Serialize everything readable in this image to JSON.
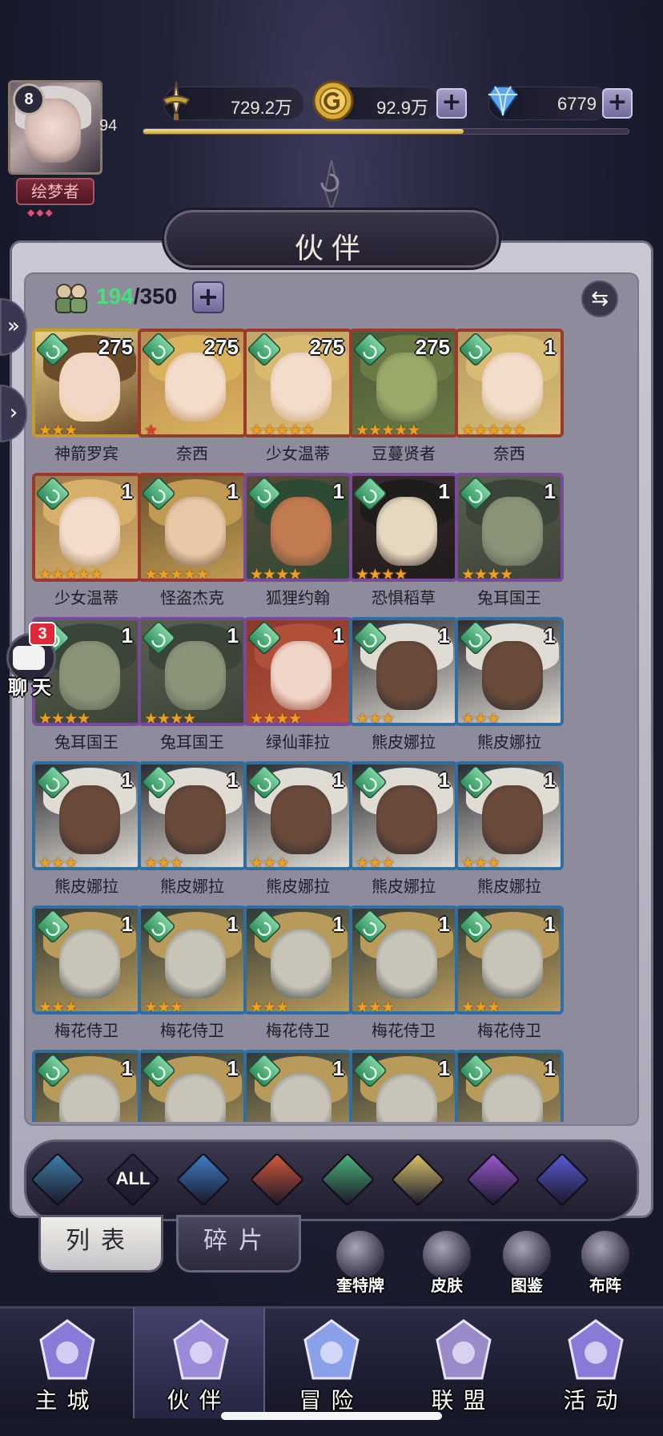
{
  "player": {
    "level": "8",
    "exp_value": "94",
    "exp_fraction": 0.66,
    "title_badge": "绘梦者"
  },
  "resources": {
    "power": "729.2万",
    "gold": "92.9万",
    "gems": "6779",
    "plus": "+"
  },
  "page_title": "伙伴",
  "roster": {
    "current": "194",
    "max": "/350"
  },
  "companions": [
    {
      "name": "神箭罗宾",
      "level": "275",
      "stars": 3,
      "frame": "gold",
      "palette": [
        "#e9d08a",
        "#6b4a2a",
        "#f2d6c8"
      ]
    },
    {
      "name": "奈西",
      "level": "275",
      "stars": 1,
      "frame": "red",
      "palette": [
        "#b98a52",
        "#d9b25e",
        "#f4dccb"
      ]
    },
    {
      "name": "少女温蒂",
      "level": "275",
      "stars": 5,
      "frame": "red",
      "palette": [
        "#c2a36a",
        "#d9b870",
        "#f3dccc"
      ]
    },
    {
      "name": "豆蔓贤者",
      "level": "275",
      "stars": 5,
      "frame": "red",
      "palette": [
        "#4a5a38",
        "#6a7a44",
        "#9aa86a"
      ]
    },
    {
      "name": "奈西",
      "level": "1",
      "stars": 5,
      "frame": "red",
      "palette": [
        "#b99a62",
        "#d9bc74",
        "#f3dccc"
      ]
    },
    {
      "name": "少女温蒂",
      "level": "1",
      "stars": 5,
      "frame": "red",
      "palette": [
        "#9a7a4a",
        "#d6b06a",
        "#f3dccc"
      ]
    },
    {
      "name": "怪盗杰克",
      "level": "1",
      "stars": 5,
      "frame": "red",
      "palette": [
        "#6a5230",
        "#c09a52",
        "#e9c8a8"
      ]
    },
    {
      "name": "狐狸约翰",
      "level": "1",
      "stars": 4,
      "frame": "purple",
      "palette": [
        "#5a4a3a",
        "#2f4a34",
        "#c27a50"
      ]
    },
    {
      "name": "恐惧稻草",
      "level": "1",
      "stars": 4,
      "frame": "purple",
      "palette": [
        "#3a2a2a",
        "#1f1c1c",
        "#e6d8c0"
      ]
    },
    {
      "name": "兔耳国王",
      "level": "1",
      "stars": 4,
      "frame": "purple",
      "palette": [
        "#5a6050",
        "#3b4438",
        "#8a9478"
      ]
    },
    {
      "name": "兔耳国王",
      "level": "1",
      "stars": 4,
      "frame": "purple",
      "palette": [
        "#5a6050",
        "#3b4438",
        "#8a9478"
      ]
    },
    {
      "name": "兔耳国王",
      "level": "1",
      "stars": 4,
      "frame": "purple",
      "palette": [
        "#5a6050",
        "#3b4438",
        "#8a9478"
      ]
    },
    {
      "name": "绿仙菲拉",
      "level": "1",
      "stars": 4,
      "frame": "purple",
      "palette": [
        "#8a3a2a",
        "#b0503a",
        "#f0d6c8"
      ]
    },
    {
      "name": "熊皮娜拉",
      "level": "1",
      "stars": 3,
      "frame": "blue",
      "palette": [
        "#2a2a30",
        "#e0dcd4",
        "#6a4a3a"
      ]
    },
    {
      "name": "熊皮娜拉",
      "level": "1",
      "stars": 3,
      "frame": "blue",
      "palette": [
        "#2a2a30",
        "#e0dcd4",
        "#6a4a3a"
      ]
    },
    {
      "name": "熊皮娜拉",
      "level": "1",
      "stars": 3,
      "frame": "blue",
      "palette": [
        "#2a2a30",
        "#e0dcd4",
        "#6a4a3a"
      ]
    },
    {
      "name": "熊皮娜拉",
      "level": "1",
      "stars": 3,
      "frame": "blue",
      "palette": [
        "#2a2a30",
        "#e0dcd4",
        "#6a4a3a"
      ]
    },
    {
      "name": "熊皮娜拉",
      "level": "1",
      "stars": 3,
      "frame": "blue",
      "palette": [
        "#2a2a30",
        "#e0dcd4",
        "#6a4a3a"
      ]
    },
    {
      "name": "熊皮娜拉",
      "level": "1",
      "stars": 3,
      "frame": "blue",
      "palette": [
        "#2a2a30",
        "#e0dcd4",
        "#6a4a3a"
      ]
    },
    {
      "name": "熊皮娜拉",
      "level": "1",
      "stars": 3,
      "frame": "blue",
      "palette": [
        "#2a2a30",
        "#e0dcd4",
        "#6a4a3a"
      ]
    },
    {
      "name": "梅花侍卫",
      "level": "1",
      "stars": 3,
      "frame": "blue",
      "palette": [
        "#2e3a3a",
        "#b89a5a",
        "#c8c4b8"
      ]
    },
    {
      "name": "梅花侍卫",
      "level": "1",
      "stars": 3,
      "frame": "blue",
      "palette": [
        "#2e3a3a",
        "#b89a5a",
        "#c8c4b8"
      ]
    },
    {
      "name": "梅花侍卫",
      "level": "1",
      "stars": 3,
      "frame": "blue",
      "palette": [
        "#2e3a3a",
        "#b89a5a",
        "#c8c4b8"
      ]
    },
    {
      "name": "梅花侍卫",
      "level": "1",
      "stars": 3,
      "frame": "blue",
      "palette": [
        "#2e3a3a",
        "#b89a5a",
        "#c8c4b8"
      ]
    },
    {
      "name": "梅花侍卫",
      "level": "1",
      "stars": 3,
      "frame": "blue",
      "palette": [
        "#2e3a3a",
        "#b89a5a",
        "#c8c4b8"
      ]
    },
    {
      "name": "",
      "level": "1",
      "stars": 0,
      "frame": "blue",
      "palette": [
        "#2e3a3a",
        "#b89a5a",
        "#c8c4b8"
      ]
    },
    {
      "name": "",
      "level": "1",
      "stars": 0,
      "frame": "blue",
      "palette": [
        "#2e3a3a",
        "#b89a5a",
        "#c8c4b8"
      ]
    },
    {
      "name": "",
      "level": "1",
      "stars": 0,
      "frame": "blue",
      "palette": [
        "#2e3a3a",
        "#b89a5a",
        "#c8c4b8"
      ]
    },
    {
      "name": "",
      "level": "1",
      "stars": 0,
      "frame": "blue",
      "palette": [
        "#2e3a3a",
        "#b89a5a",
        "#c8c4b8"
      ]
    },
    {
      "name": "",
      "level": "1",
      "stars": 0,
      "frame": "blue",
      "palette": [
        "#2e3a3a",
        "#b89a5a",
        "#c8c4b8"
      ]
    }
  ],
  "filters": [
    {
      "id": "class",
      "label": "",
      "color": "#3f7fa8"
    },
    {
      "id": "all",
      "label": "ALL",
      "color": "#2b2940"
    },
    {
      "id": "water",
      "label": "",
      "color": "#3f7fc8"
    },
    {
      "id": "fire",
      "label": "",
      "color": "#d25a3a"
    },
    {
      "id": "wind",
      "label": "",
      "color": "#4cb47a"
    },
    {
      "id": "light",
      "label": "",
      "color": "#d9c46a"
    },
    {
      "id": "moon",
      "label": "",
      "color": "#9a5ad0"
    },
    {
      "id": "cosmos",
      "label": "",
      "color": "#5a5ad8"
    }
  ],
  "tabs": {
    "list": "列表",
    "shards": "碎片"
  },
  "quick_actions": [
    {
      "id": "cards",
      "label": "奎特牌"
    },
    {
      "id": "skins",
      "label": "皮肤"
    },
    {
      "id": "codex",
      "label": "图鉴"
    },
    {
      "id": "formation",
      "label": "布阵"
    }
  ],
  "chat": {
    "badge": "3",
    "label": "聊天"
  },
  "nav": [
    {
      "id": "castle",
      "label": "主城",
      "color": "#8a7ad8"
    },
    {
      "id": "companions",
      "label": "伙伴",
      "color": "#9a8ad8"
    },
    {
      "id": "adventure",
      "label": "冒险",
      "color": "#8aa0e8"
    },
    {
      "id": "alliance",
      "label": "联盟",
      "color": "#9a8ac8"
    },
    {
      "id": "events",
      "label": "活动",
      "color": "#8a7ad8"
    }
  ],
  "colors": {
    "star": "#f0a020",
    "star_red": "#e03a2a",
    "roster_current": "#47e07a"
  }
}
